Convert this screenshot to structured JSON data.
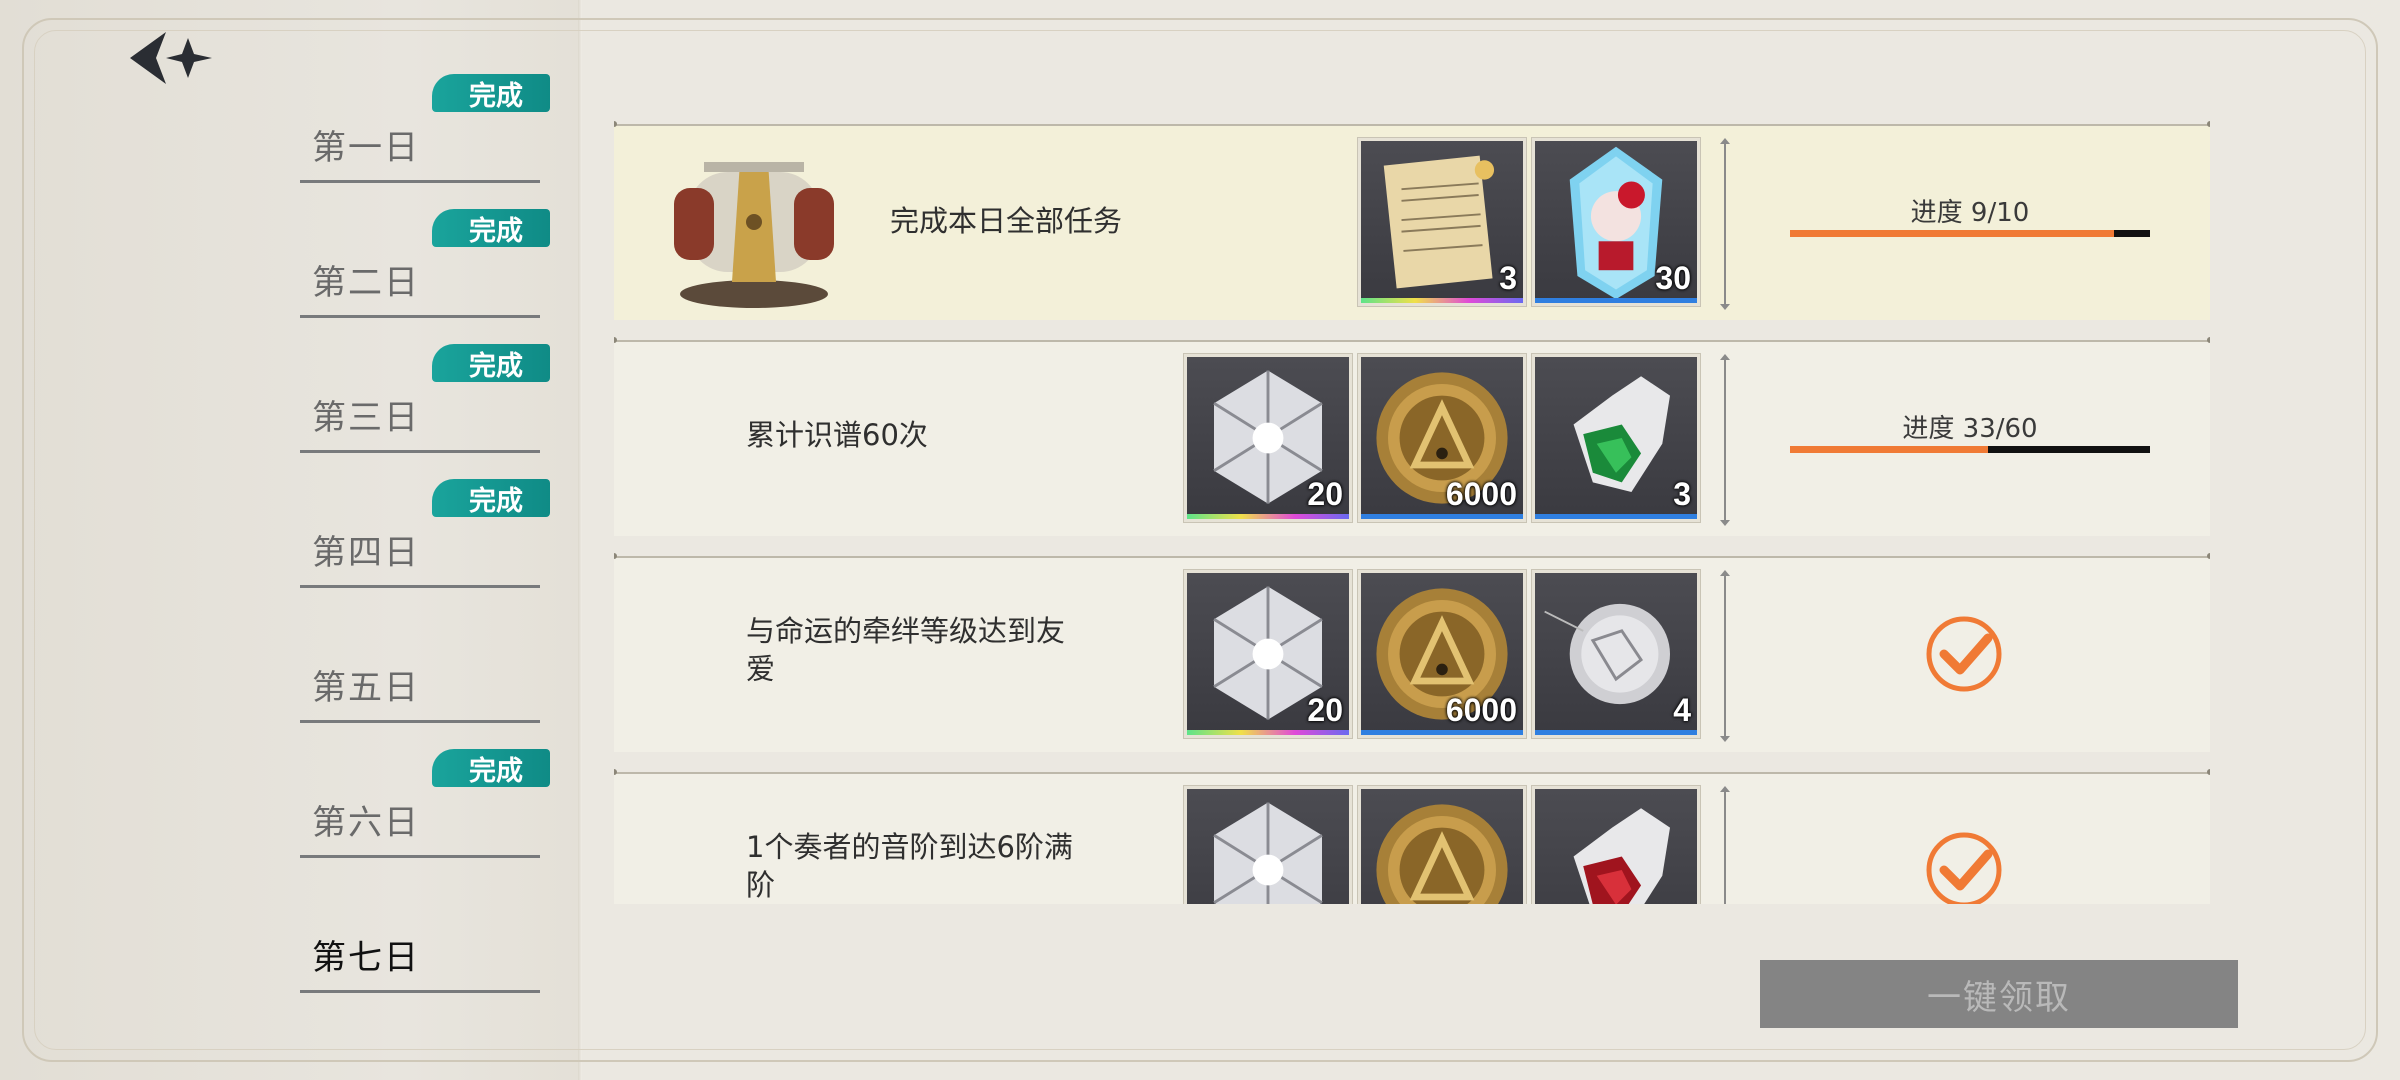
{
  "sidebar": {
    "days": [
      {
        "label": "第一日",
        "badge": "完成",
        "done": true,
        "active": false
      },
      {
        "label": "第二日",
        "badge": "完成",
        "done": true,
        "active": false
      },
      {
        "label": "第三日",
        "badge": "完成",
        "done": true,
        "active": false
      },
      {
        "label": "第四日",
        "badge": "完成",
        "done": true,
        "active": false
      },
      {
        "label": "第五日",
        "badge": "",
        "done": false,
        "active": false
      },
      {
        "label": "第六日",
        "badge": "完成",
        "done": true,
        "active": false
      },
      {
        "label": "第七日",
        "badge": "",
        "done": false,
        "active": true
      }
    ]
  },
  "tasks": [
    {
      "title": "完成本日全部任务",
      "highlight": true,
      "icon": "treasure-chest-icon",
      "rewards": [
        {
          "icon": "music-sheet-icon",
          "qty": "3",
          "rarity_color": "rainbow"
        },
        {
          "icon": "character-crystal-icon",
          "qty": "30",
          "rarity_color": "#2f7fe0"
        }
      ],
      "status": "progress",
      "progress_label": "进度 9/10",
      "progress_value": 0.9
    },
    {
      "title": "累计识谱60次",
      "highlight": false,
      "icon": "",
      "rewards": [
        {
          "icon": "white-crystal-icon",
          "qty": "20",
          "rarity_color": "rainbow"
        },
        {
          "icon": "gold-coin-icon",
          "qty": "6000",
          "rarity_color": "#2f7fe0"
        },
        {
          "icon": "green-crystal-hand-icon",
          "qty": "3",
          "rarity_color": "#2f7fe0"
        }
      ],
      "status": "progress",
      "progress_label": "进度 33/60",
      "progress_value": 0.55
    },
    {
      "title": "与命运的牵绊等级达到友爱",
      "highlight": false,
      "icon": "",
      "rewards": [
        {
          "icon": "white-crystal-icon",
          "qty": "20",
          "rarity_color": "rainbow"
        },
        {
          "icon": "gold-coin-icon",
          "qty": "6000",
          "rarity_color": "#2f7fe0"
        },
        {
          "icon": "constellation-orb-icon",
          "qty": "4",
          "rarity_color": "#2f7fe0"
        }
      ],
      "status": "completed"
    },
    {
      "title": "1个奏者的音阶到达6阶满阶",
      "highlight": false,
      "icon": "",
      "rewards": [
        {
          "icon": "white-crystal-icon",
          "qty": "",
          "rarity_color": "rainbow"
        },
        {
          "icon": "gold-coin-icon",
          "qty": "",
          "rarity_color": "#2f7fe0"
        },
        {
          "icon": "red-crystal-hand-icon",
          "qty": "",
          "rarity_color": "#2f7fe0"
        }
      ],
      "status": "completed"
    }
  ],
  "footer": {
    "claim_all_label": "一键领取"
  },
  "colors": {
    "accent_orange": "#f07a35",
    "badge_teal": "#129a93",
    "highlight_row": "#f3f0d9",
    "row_bg": "#f1efe6"
  }
}
